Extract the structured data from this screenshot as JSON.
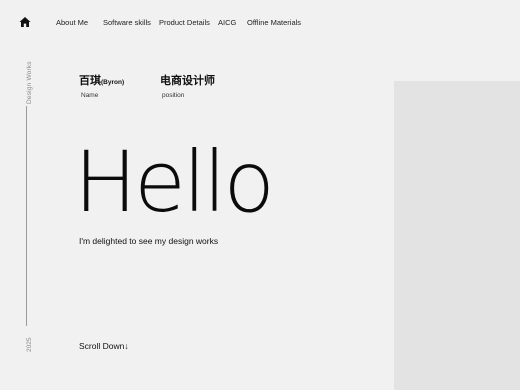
{
  "nav": {
    "items": [
      {
        "label": "About Me"
      },
      {
        "label": "Software skills"
      },
      {
        "label": "Product Details"
      },
      {
        "label": "AICG"
      },
      {
        "label": "Offline Materials"
      }
    ]
  },
  "sidebar": {
    "label": "Design Works",
    "year": "2025"
  },
  "profile": {
    "name_value": "百琪",
    "name_suffix": "(Byron)",
    "name_label": "Name",
    "position_value": "电商设计师",
    "position_label": "position"
  },
  "hero": {
    "title": "Hello",
    "tagline": "I'm delighted to see my design works",
    "scroll_label": "Scroll Down↓"
  }
}
